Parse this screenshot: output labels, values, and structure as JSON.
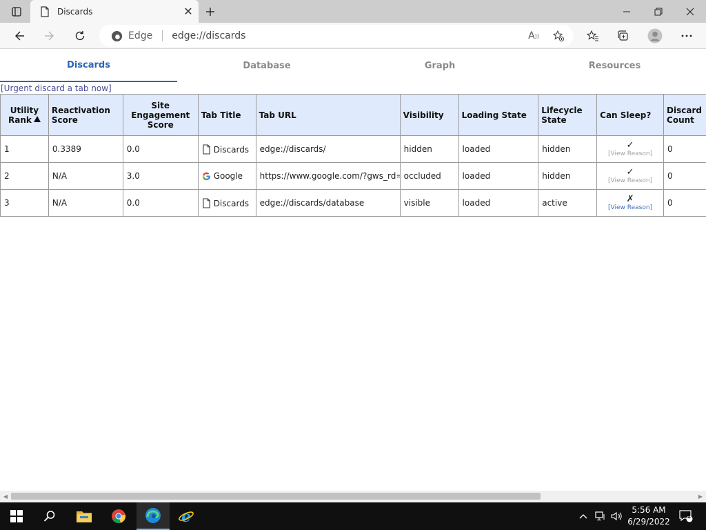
{
  "browser": {
    "tab_title": "Discards",
    "address_label": "Edge",
    "address_url": "edge://discards"
  },
  "content_tabs": [
    {
      "label": "Discards",
      "active": true
    },
    {
      "label": "Database",
      "active": false
    },
    {
      "label": "Graph",
      "active": false
    },
    {
      "label": "Resources",
      "active": false
    }
  ],
  "urgent_link": "[Urgent discard a tab now]",
  "table": {
    "headers": {
      "utility_rank": "Utility Rank",
      "reactivation_score": "Reactivation Score",
      "site_engagement_score": "Site Engagement Score",
      "tab_title": "Tab Title",
      "tab_url": "Tab URL",
      "visibility": "Visibility",
      "loading_state": "Loading State",
      "lifecycle_state": "Lifecycle State",
      "can_sleep": "Can Sleep?",
      "discard_count": "Discard Count"
    },
    "rows": [
      {
        "rank": "1",
        "reactivation": "0.3389",
        "engagement": "0.0",
        "title": "Discards",
        "favicon": "page-icon",
        "url": "edge://discards/",
        "visibility": "hidden",
        "loading": "loaded",
        "lifecycle": "hidden",
        "can_sleep": "✓",
        "reason": "[View Reason]",
        "reason_link": false,
        "discards": "0"
      },
      {
        "rank": "2",
        "reactivation": "N/A",
        "engagement": "3.0",
        "title": "Google",
        "favicon": "google-icon",
        "url": "https://www.google.com/?gws_rd=ssl",
        "visibility": "occluded",
        "loading": "loaded",
        "lifecycle": "hidden",
        "can_sleep": "✓",
        "reason": "[View Reason]",
        "reason_link": false,
        "discards": "0"
      },
      {
        "rank": "3",
        "reactivation": "N/A",
        "engagement": "0.0",
        "title": "Discards",
        "favicon": "page-icon",
        "url": "edge://discards/database",
        "visibility": "visible",
        "loading": "loaded",
        "lifecycle": "active",
        "can_sleep": "✗",
        "reason": "[View Reason]",
        "reason_link": true,
        "discards": "0"
      }
    ]
  },
  "taskbar": {
    "time": "5:56 AM",
    "date": "6/29/2022",
    "notification_count": "1"
  },
  "colors": {
    "accent": "#2b66b5",
    "header_bg": "#dfeafc",
    "taskbar_bg": "#101010"
  }
}
